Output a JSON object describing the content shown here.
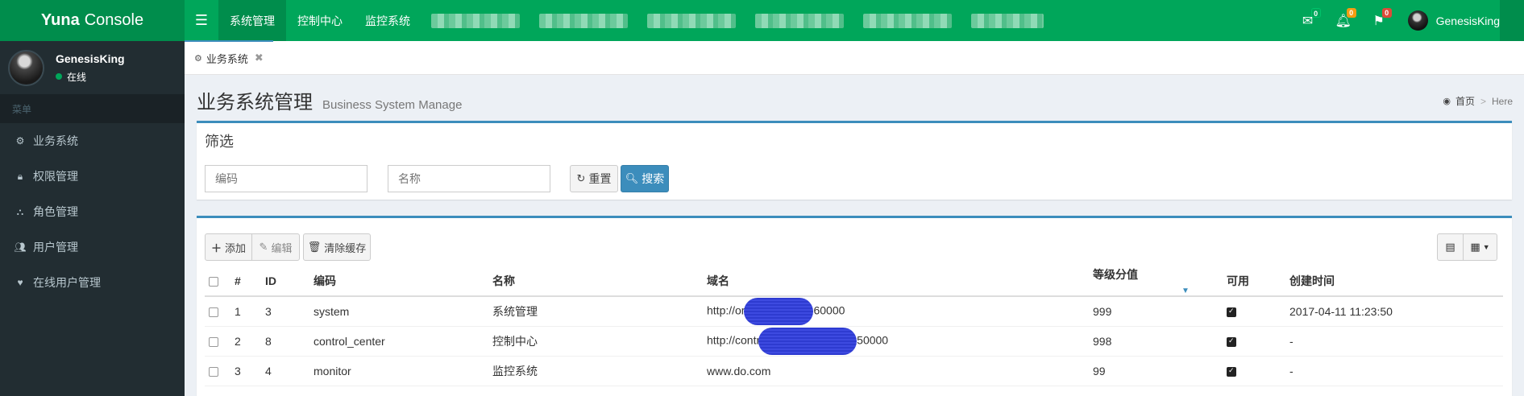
{
  "header": {
    "logo_bold": "Yuna",
    "logo_rest": "Console",
    "nav": [
      {
        "label": "系统管理",
        "active": true
      },
      {
        "label": "控制中心",
        "active": false
      },
      {
        "label": "监控系统",
        "active": false
      }
    ],
    "badges": {
      "mail": "0",
      "bell": "0",
      "flag": "0"
    },
    "user_name": "GenesisKing",
    "accent_color": "#00a65a"
  },
  "sidebar": {
    "user_name": "GenesisKing",
    "status": "在线",
    "menu_header": "菜单",
    "items": [
      {
        "label": "业务系统",
        "icon": "gears-icon"
      },
      {
        "label": "权限管理",
        "icon": "lock-icon"
      },
      {
        "label": "角色管理",
        "icon": "sitemap-icon"
      },
      {
        "label": "用户管理",
        "icon": "users-icon"
      },
      {
        "label": "在线用户管理",
        "icon": "heartbeat-icon"
      }
    ]
  },
  "tabs": [
    {
      "label": "业务系统"
    }
  ],
  "page": {
    "title": "业务系统管理",
    "subtitle": "Business System Manage",
    "breadcrumb_home": "首页",
    "breadcrumb_here": "Here"
  },
  "filter": {
    "title": "筛选",
    "code_placeholder": "编码",
    "name_placeholder": "名称",
    "reset_label": "重置",
    "search_label": "搜索"
  },
  "toolbar": {
    "add_label": "添加",
    "edit_label": "编辑",
    "clear_cache_label": "清除缓存"
  },
  "table": {
    "columns": [
      "#",
      "ID",
      "编码",
      "名称",
      "域名",
      "等级分值",
      "可用",
      "创建时间"
    ],
    "rows": [
      {
        "index": "1",
        "id": "3",
        "code": "system",
        "name": "系统管理",
        "domain_prefix": "http://om",
        "domain_suffix": "60000",
        "score": "999",
        "enabled": true,
        "created": "2017-04-11 11:23:50"
      },
      {
        "index": "2",
        "id": "8",
        "code": "control_center",
        "name": "控制中心",
        "domain_prefix": "http://contr",
        "domain_suffix": "50000",
        "score": "998",
        "enabled": true,
        "created": "-"
      },
      {
        "index": "3",
        "id": "4",
        "code": "monitor",
        "name": "监控系统",
        "domain_prefix": "www.do.com",
        "domain_suffix": "",
        "score": "99",
        "enabled": true,
        "created": "-"
      }
    ]
  }
}
